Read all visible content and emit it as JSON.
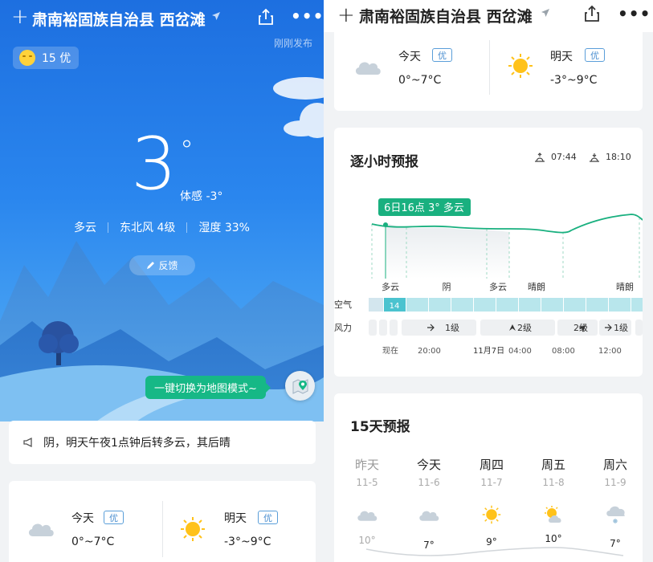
{
  "app": {
    "location": "肃南裕固族自治县 西岔滩",
    "published": "刚刚发布",
    "aqi_badge": "15 优"
  },
  "current": {
    "temp": "3",
    "degree": "°",
    "feels_like": "体感 -3°",
    "condition": "多云",
    "wind": "东北风 4级",
    "humidity": "湿度 33%",
    "feedback_label": "反馈",
    "map_tip": "一键切换为地图模式~",
    "notice": "阴，明天午夜1点钟后转多云，其后晴"
  },
  "days_summary": {
    "today": {
      "label": "今天",
      "badge": "优",
      "range": "0°~7°C",
      "icon": "cloud-icon"
    },
    "tomorrow": {
      "label": "明天",
      "badge": "优",
      "range": "-3°~9°C",
      "icon": "sun-icon"
    }
  },
  "hourly": {
    "title": "逐小时预报",
    "sunrise": "07:44",
    "sunset": "18:10",
    "tooltip": "6日16点 3° 多云",
    "conditions": [
      "多云",
      "阴",
      "多云",
      "晴朗",
      "晴朗"
    ],
    "air_label": "空气",
    "air_value": "14",
    "wind_label": "风力",
    "wind_levels": [
      "1级",
      "2级",
      "2级",
      "1级"
    ],
    "times": [
      "现在",
      "20:00",
      "11月7日",
      "04:00",
      "08:00",
      "12:00"
    ]
  },
  "fifteen": {
    "title": "15天预报",
    "days": [
      {
        "week": "昨天",
        "date": "11-5",
        "temp": "10°",
        "icon": "cloud-icon",
        "past": true
      },
      {
        "week": "今天",
        "date": "11-6",
        "temp": "7°",
        "icon": "cloud-icon",
        "past": false
      },
      {
        "week": "周四",
        "date": "11-7",
        "temp": "9°",
        "icon": "sun-icon",
        "past": false
      },
      {
        "week": "周五",
        "date": "11-8",
        "temp": "10°",
        "icon": "sun-cloud-icon",
        "past": false
      },
      {
        "week": "周六",
        "date": "11-9",
        "temp": "7°",
        "icon": "snow-cloud-icon",
        "past": false
      }
    ]
  },
  "colors": {
    "sky_top": "#1d6fe0",
    "accent_green": "#16b886",
    "badge_blue": "#4b8fd0",
    "curve": "#19b07f"
  }
}
